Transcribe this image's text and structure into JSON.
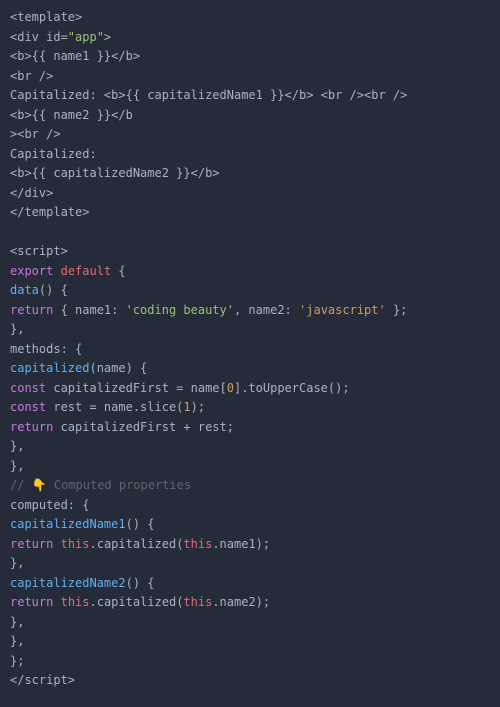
{
  "code": {
    "lines": [
      [
        {
          "t": "<template>",
          "c": "c-tag"
        }
      ],
      [
        {
          "t": "<div id=",
          "c": "c-tag"
        },
        {
          "t": "\"app\"",
          "c": "c-string"
        },
        {
          "t": ">",
          "c": "c-tag"
        }
      ],
      [
        {
          "t": "<b>{{ name1 }}</b>",
          "c": "c-tag"
        }
      ],
      [
        {
          "t": "<br />",
          "c": "c-tag"
        }
      ],
      [
        {
          "t": "Capitalized: <b>{{ capitalizedName1 }}</b> <br /><br />",
          "c": "c-tag"
        }
      ],
      [
        {
          "t": "<b>{{ name2 }}</b",
          "c": "c-tag"
        }
      ],
      [
        {
          "t": "><br />",
          "c": "c-tag"
        }
      ],
      [
        {
          "t": "Capitalized:",
          "c": "c-tag"
        }
      ],
      [
        {
          "t": "<b>{{ capitalizedName2 }}</b>",
          "c": "c-tag"
        }
      ],
      [
        {
          "t": "</div>",
          "c": "c-tag"
        }
      ],
      [
        {
          "t": "</template>",
          "c": "c-tag"
        }
      ],
      [
        {
          "t": "",
          "c": "c-default"
        }
      ],
      [
        {
          "t": "<script>",
          "c": "c-tag"
        }
      ],
      [
        {
          "t": "export",
          "c": "c-keyword"
        },
        {
          "t": " ",
          "c": "c-default"
        },
        {
          "t": "default",
          "c": "c-keyword2"
        },
        {
          "t": " {",
          "c": "c-punc"
        }
      ],
      [
        {
          "t": "data",
          "c": "c-func"
        },
        {
          "t": "() {",
          "c": "c-punc"
        }
      ],
      [
        {
          "t": "return",
          "c": "c-keyword"
        },
        {
          "t": " { name1: ",
          "c": "c-default"
        },
        {
          "t": "'coding beauty'",
          "c": "c-string"
        },
        {
          "t": ", name2: ",
          "c": "c-default"
        },
        {
          "t": "'javascript'",
          "c": "c-string2"
        },
        {
          "t": " };",
          "c": "c-punc"
        }
      ],
      [
        {
          "t": "},",
          "c": "c-punc"
        }
      ],
      [
        {
          "t": "methods: {",
          "c": "c-default"
        }
      ],
      [
        {
          "t": "capitalized",
          "c": "c-func"
        },
        {
          "t": "(name) {",
          "c": "c-default"
        }
      ],
      [
        {
          "t": "const",
          "c": "c-keyword"
        },
        {
          "t": " capitalizedFirst = name[",
          "c": "c-default"
        },
        {
          "t": "0",
          "c": "c-num"
        },
        {
          "t": "].toUpperCase();",
          "c": "c-default"
        }
      ],
      [
        {
          "t": "const",
          "c": "c-keyword"
        },
        {
          "t": " rest = name.slice(",
          "c": "c-default"
        },
        {
          "t": "1",
          "c": "c-num"
        },
        {
          "t": ");",
          "c": "c-default"
        }
      ],
      [
        {
          "t": "return",
          "c": "c-keyword"
        },
        {
          "t": " capitalizedFirst + rest;",
          "c": "c-default"
        }
      ],
      [
        {
          "t": "},",
          "c": "c-punc"
        }
      ],
      [
        {
          "t": "},",
          "c": "c-punc"
        }
      ],
      [
        {
          "t": "// 👇 Computed properties",
          "c": "c-comment"
        }
      ],
      [
        {
          "t": "computed: {",
          "c": "c-default"
        }
      ],
      [
        {
          "t": "capitalizedName1",
          "c": "c-func"
        },
        {
          "t": "() {",
          "c": "c-punc"
        }
      ],
      [
        {
          "t": "return",
          "c": "c-keyword"
        },
        {
          "t": " ",
          "c": "c-default"
        },
        {
          "t": "this",
          "c": "c-this"
        },
        {
          "t": ".capitalized(",
          "c": "c-default"
        },
        {
          "t": "this",
          "c": "c-this"
        },
        {
          "t": ".name1);",
          "c": "c-default"
        }
      ],
      [
        {
          "t": "},",
          "c": "c-punc"
        }
      ],
      [
        {
          "t": "capitalizedName2",
          "c": "c-func"
        },
        {
          "t": "() {",
          "c": "c-punc"
        }
      ],
      [
        {
          "t": "return",
          "c": "c-keyword"
        },
        {
          "t": " ",
          "c": "c-default"
        },
        {
          "t": "this",
          "c": "c-this"
        },
        {
          "t": ".capitalized(",
          "c": "c-default"
        },
        {
          "t": "this",
          "c": "c-this"
        },
        {
          "t": ".name2);",
          "c": "c-default"
        }
      ],
      [
        {
          "t": "},",
          "c": "c-punc"
        }
      ],
      [
        {
          "t": "},",
          "c": "c-punc"
        }
      ],
      [
        {
          "t": "};",
          "c": "c-punc"
        }
      ],
      [
        {
          "t": "</scr",
          "c": "c-tag"
        },
        {
          "t": "ipt>",
          "c": "c-tag"
        }
      ]
    ]
  }
}
